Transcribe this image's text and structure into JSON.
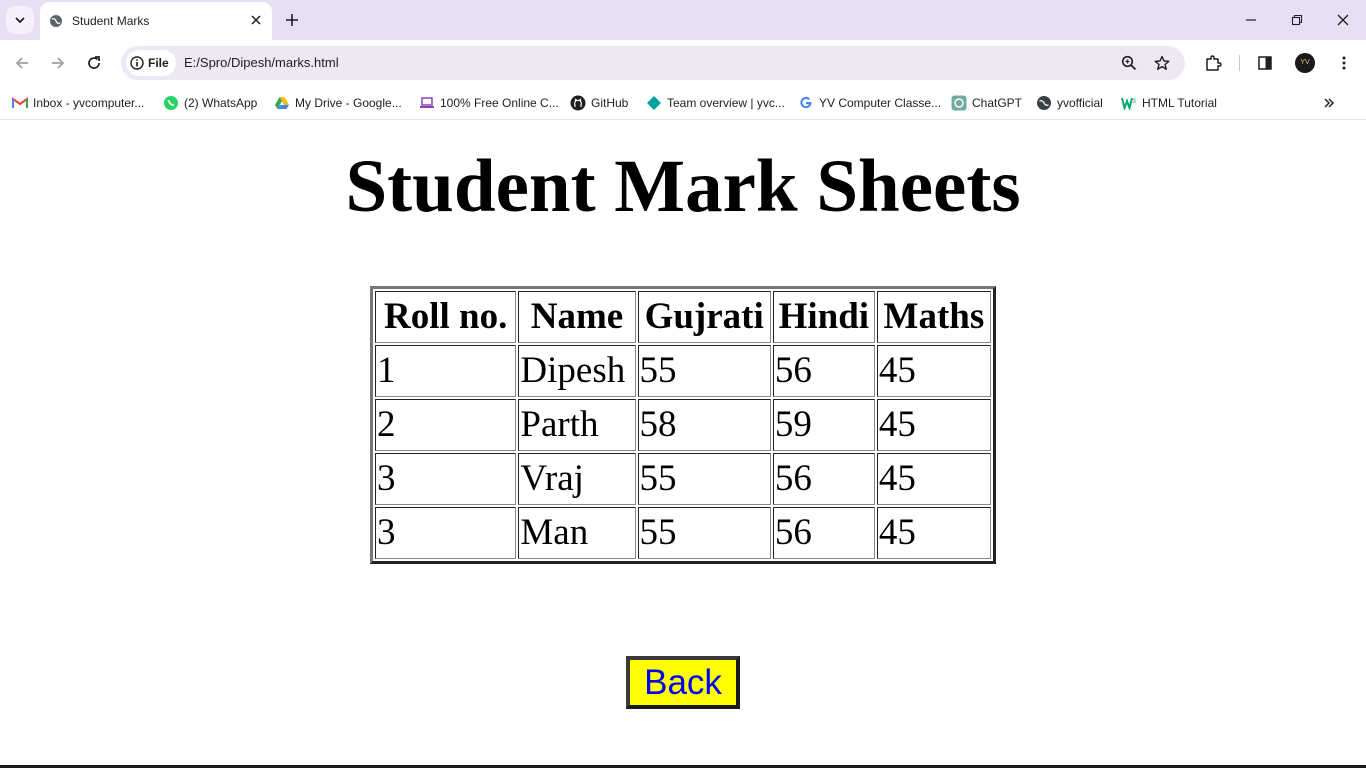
{
  "browser": {
    "tab_title": "Student Marks",
    "address_chip": "File",
    "url": "E:/Spro/Dipesh/marks.html",
    "avatar_text": "YV",
    "bookmarks": [
      {
        "label": "Inbox - yvcomputer...",
        "icon": "gmail-icon"
      },
      {
        "label": "(2) WhatsApp",
        "icon": "whatsapp-icon"
      },
      {
        "label": "My Drive - Google...",
        "icon": "google-drive-icon"
      },
      {
        "label": "100% Free Online C...",
        "icon": "laptop-icon"
      },
      {
        "label": "GitHub",
        "icon": "github-icon"
      },
      {
        "label": "Team overview | yvc...",
        "icon": "diamond-icon"
      },
      {
        "label": "YV Computer Classe...",
        "icon": "google-icon"
      },
      {
        "label": "ChatGPT",
        "icon": "chatgpt-icon"
      },
      {
        "label": "yvofficial",
        "icon": "globe-icon"
      },
      {
        "label": "HTML Tutorial",
        "icon": "w3schools-icon"
      }
    ]
  },
  "page": {
    "title": "Student Mark Sheets",
    "table": {
      "headers": [
        "Roll no.",
        "Name",
        "Gujrati",
        "Hindi",
        "Maths"
      ],
      "rows": [
        [
          "1",
          "Dipesh",
          "55",
          "56",
          "45"
        ],
        [
          "2",
          "Parth",
          "58",
          "59",
          "45"
        ],
        [
          "3",
          "Vraj",
          "55",
          "56",
          "45"
        ],
        [
          "3",
          "Man",
          "55",
          "56",
          "45"
        ]
      ]
    },
    "back_button": "Back"
  },
  "colors": {
    "tabbar_bg": "#e8dff5",
    "omnibox_bg": "#ede8f4",
    "back_button_bg": "#ffff00",
    "back_button_text": "#0000ff"
  }
}
